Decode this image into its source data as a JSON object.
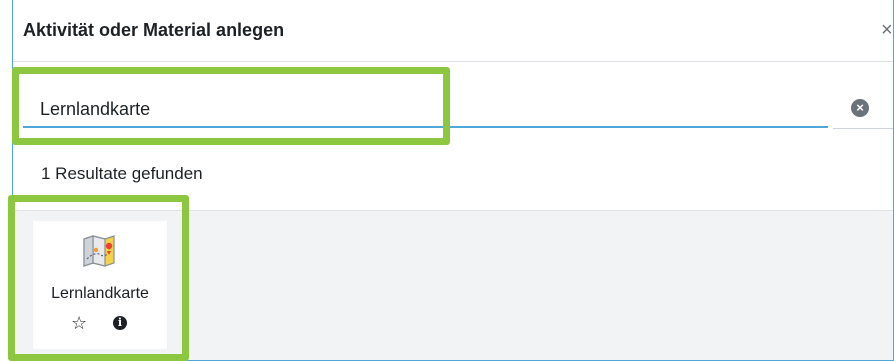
{
  "modal": {
    "title": "Aktivität oder Material anlegen",
    "close_label": "×"
  },
  "search": {
    "value": "Lernlandkarte",
    "clear_label": "×"
  },
  "results": {
    "summary": "1 Resultate gefunden",
    "items": [
      {
        "label": "Lernlandkarte",
        "icon": "treasure-map-icon",
        "star": "☆",
        "info": "i"
      }
    ]
  },
  "annotations": {
    "highlight_color": "#8dc63f",
    "accent_color": "#4fa6d8"
  }
}
